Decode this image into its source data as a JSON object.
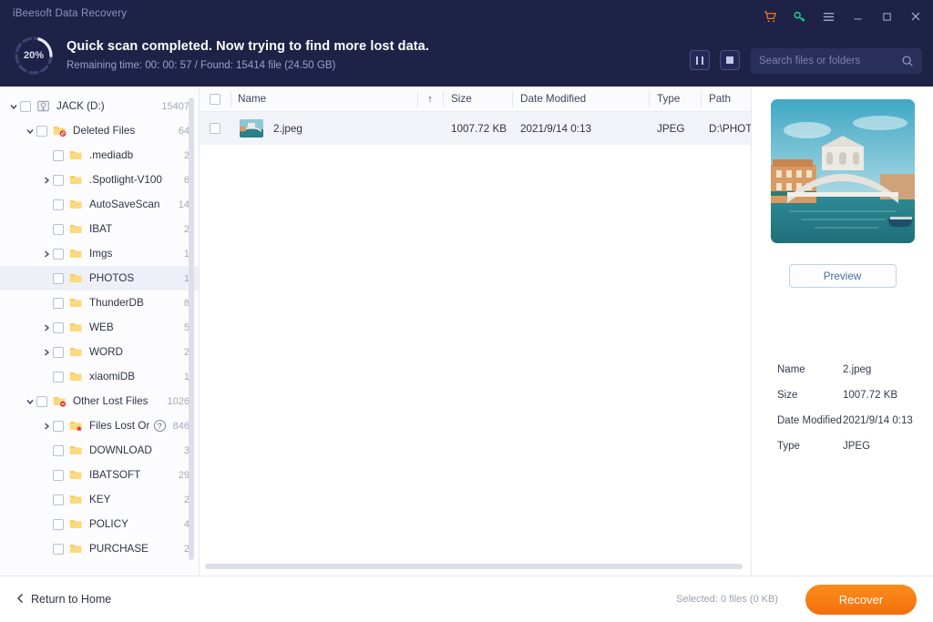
{
  "window": {
    "app_title": "iBeesoft Data Recovery",
    "controls": [
      {
        "name": "cart-icon",
        "glyph": "cart"
      },
      {
        "name": "key-icon",
        "glyph": "key"
      },
      {
        "name": "menu-icon",
        "glyph": "menu"
      },
      {
        "name": "minimize-icon",
        "glyph": "minimize"
      },
      {
        "name": "maximize-icon",
        "glyph": "maximize"
      },
      {
        "name": "close-icon",
        "glyph": "close"
      }
    ],
    "accent_orange": "#f47b20",
    "header_bg": "#1e2246"
  },
  "scan": {
    "percent": "20%",
    "percent_value": 20,
    "title": "Quick scan completed. Now trying to find more lost data.",
    "subtitle": "Remaining time: 00: 00: 57 / Found: 15414 file (24.50 GB)",
    "pause_label": "Pause",
    "stop_label": "Stop"
  },
  "search": {
    "placeholder": "Search files or folders",
    "value": ""
  },
  "sidebar": {
    "items": [
      {
        "label": "JACK (D:)",
        "count": "15407",
        "depth": 0,
        "twisty": "open",
        "icon": "drive",
        "selected": false
      },
      {
        "label": "Deleted Files",
        "count": "64",
        "depth": 1,
        "twisty": "open",
        "icon": "folder-deleted",
        "selected": false
      },
      {
        "label": ".mediadb",
        "count": "2",
        "depth": 2,
        "twisty": "none",
        "icon": "folder",
        "selected": false
      },
      {
        "label": ".Spotlight-V100",
        "count": "6",
        "depth": 2,
        "twisty": "closed",
        "icon": "folder",
        "selected": false
      },
      {
        "label": "AutoSaveScan",
        "count": "14",
        "depth": 2,
        "twisty": "none",
        "icon": "folder",
        "selected": false
      },
      {
        "label": "IBAT",
        "count": "2",
        "depth": 2,
        "twisty": "none",
        "icon": "folder",
        "selected": false
      },
      {
        "label": "Imgs",
        "count": "1",
        "depth": 2,
        "twisty": "closed",
        "icon": "folder",
        "selected": false
      },
      {
        "label": "PHOTOS",
        "count": "1",
        "depth": 2,
        "twisty": "none",
        "icon": "folder",
        "selected": true
      },
      {
        "label": "ThunderDB",
        "count": "8",
        "depth": 2,
        "twisty": "none",
        "icon": "folder",
        "selected": false
      },
      {
        "label": "WEB",
        "count": "5",
        "depth": 2,
        "twisty": "closed",
        "icon": "folder",
        "selected": false
      },
      {
        "label": "WORD",
        "count": "2",
        "depth": 2,
        "twisty": "closed",
        "icon": "folder",
        "selected": false
      },
      {
        "label": "xiaomiDB",
        "count": "1",
        "depth": 2,
        "twisty": "none",
        "icon": "folder",
        "selected": false
      },
      {
        "label": "Other Lost Files",
        "count": "1026",
        "depth": 1,
        "twisty": "open",
        "icon": "folder-lost",
        "selected": false
      },
      {
        "label": "Files Lost Origin...",
        "count": "846",
        "depth": 2,
        "twisty": "closed",
        "icon": "folder-star",
        "selected": false,
        "help": "?"
      },
      {
        "label": "DOWNLOAD",
        "count": "3",
        "depth": 2,
        "twisty": "none",
        "icon": "folder",
        "selected": false
      },
      {
        "label": "IBATSOFT",
        "count": "29",
        "depth": 2,
        "twisty": "none",
        "icon": "folder",
        "selected": false
      },
      {
        "label": "KEY",
        "count": "2",
        "depth": 2,
        "twisty": "none",
        "icon": "folder",
        "selected": false
      },
      {
        "label": "POLICY",
        "count": "4",
        "depth": 2,
        "twisty": "none",
        "icon": "folder",
        "selected": false
      },
      {
        "label": "PURCHASE",
        "count": "2",
        "depth": 2,
        "twisty": "none",
        "icon": "folder",
        "selected": false
      }
    ]
  },
  "filelist": {
    "columns": [
      "Name",
      "Size",
      "Date Modified",
      "Type",
      "Path"
    ],
    "sort_indicator": "↑",
    "rows": [
      {
        "name": "2.jpeg",
        "size": "1007.72 KB",
        "date_modified": "2021/9/14 0:13",
        "type": "JPEG",
        "path": "D:\\PHOTOS",
        "checked": false
      }
    ]
  },
  "preview": {
    "button_label": "Preview",
    "image_alt": "rialto-bridge-venice",
    "meta": [
      {
        "key": "Name",
        "value": "2.jpeg"
      },
      {
        "key": "Size",
        "value": "1007.72 KB"
      },
      {
        "key": "Date Modified",
        "value": "2021/9/14 0:13"
      },
      {
        "key": "Type",
        "value": "JPEG"
      }
    ]
  },
  "footer": {
    "return_label": "Return to Home",
    "selected_info": "Selected: 0 files (0 KB)",
    "recover_label": "Recover"
  }
}
